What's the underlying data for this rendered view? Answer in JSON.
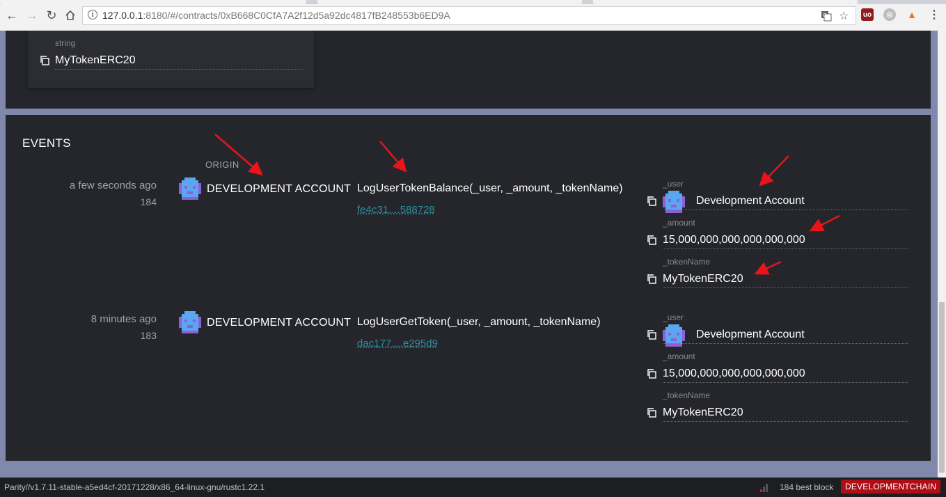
{
  "browser": {
    "url_host": "127.0.0.1",
    "url_rest": ":8180/#/contracts/0xB668C0CfA7A2f12d5a92dc4817fB248553b6ED9A"
  },
  "string_card": {
    "label": "string",
    "value": "MyTokenERC20"
  },
  "events": {
    "title": "EVENTS",
    "origin_header": "ORIGIN",
    "items": [
      {
        "time": "a few seconds ago",
        "block": "184",
        "origin": "DEVELOPMENT ACCOUNT",
        "name": "LogUserTokenBalance(_user, _amount, _tokenName)",
        "tx": "fe4c31....588728",
        "params": [
          {
            "label": "_user",
            "value": "Development Account"
          },
          {
            "label": "_amount",
            "value": "15,000,000,000,000,000,000"
          },
          {
            "label": "_tokenName",
            "value": "MyTokenERC20"
          }
        ]
      },
      {
        "time": "8 minutes ago",
        "block": "183",
        "origin": "DEVELOPMENT ACCOUNT",
        "name": "LogUserGetToken(_user, _amount, _tokenName)",
        "tx": "dac177....e295d9",
        "params": [
          {
            "label": "_user",
            "value": "Development Account"
          },
          {
            "label": "_amount",
            "value": "15,000,000,000,000,000,000"
          },
          {
            "label": "_tokenName",
            "value": "MyTokenERC20"
          }
        ]
      }
    ]
  },
  "status": {
    "version": "Parity//v1.7.11-stable-a5ed4cf-20171228/x86_64-linux-gnu/rustc1.22.1",
    "best_block": "184 best block",
    "chain": "DEVELOPMENTCHAIN"
  },
  "colors": {
    "panel": "#25262b",
    "link": "#2a8fa0",
    "annotation_arrow": "#e8141a",
    "chain_badge": "#b00e15"
  }
}
